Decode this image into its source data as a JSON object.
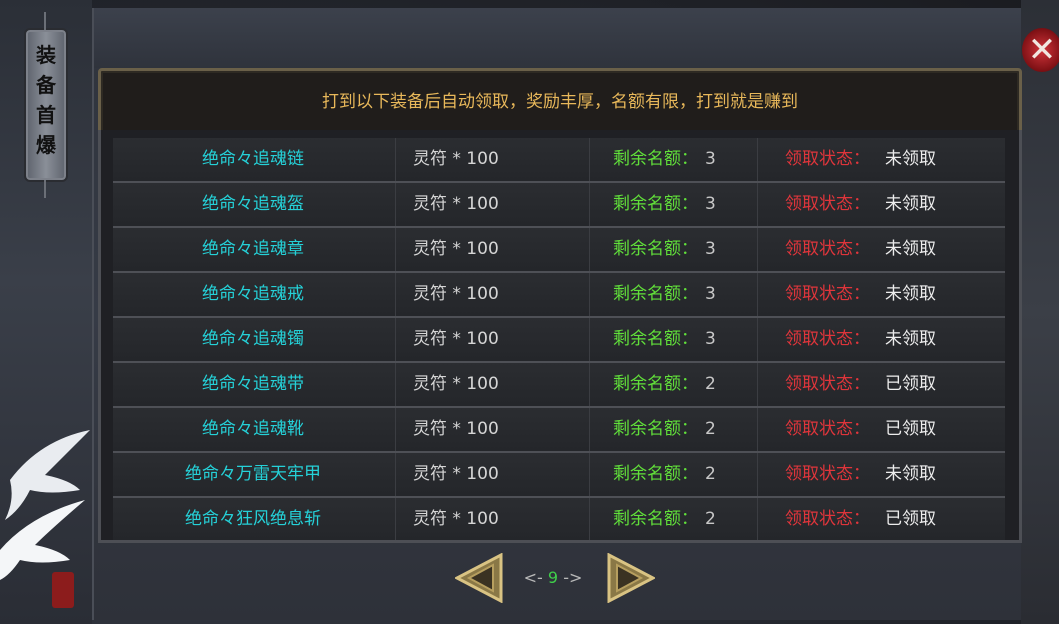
{
  "side_tab": {
    "label": [
      "装",
      "备",
      "首",
      "爆"
    ]
  },
  "banner": {
    "text": "打到以下装备后自动领取，奖励丰厚，名额有限，打到就是赚到"
  },
  "labels": {
    "quota": "剩余名额：",
    "status": "领取状态："
  },
  "rows": [
    {
      "name": "绝命々追魂链",
      "reward": "灵符 * 100",
      "quota": "3",
      "status": "未领取"
    },
    {
      "name": "绝命々追魂盔",
      "reward": "灵符 * 100",
      "quota": "3",
      "status": "未领取"
    },
    {
      "name": "绝命々追魂章",
      "reward": "灵符 * 100",
      "quota": "3",
      "status": "未领取"
    },
    {
      "name": "绝命々追魂戒",
      "reward": "灵符 * 100",
      "quota": "3",
      "status": "未领取"
    },
    {
      "name": "绝命々追魂镯",
      "reward": "灵符 * 100",
      "quota": "3",
      "status": "未领取"
    },
    {
      "name": "绝命々追魂带",
      "reward": "灵符 * 100",
      "quota": "2",
      "status": "已领取"
    },
    {
      "name": "绝命々追魂靴",
      "reward": "灵符 * 100",
      "quota": "2",
      "status": "已领取"
    },
    {
      "name": "绝命々万雷天牢甲",
      "reward": "灵符 * 100",
      "quota": "2",
      "status": "未领取"
    },
    {
      "name": "绝命々狂风绝息斩",
      "reward": "灵符 * 100",
      "quota": "2",
      "status": "已领取"
    }
  ],
  "pager": {
    "left": "<-",
    "page": "9",
    "right": "->"
  },
  "close": {
    "glyph": "✕"
  },
  "colors": {
    "name": "#25d1d8",
    "quota": "#61e03a",
    "status": "#e0353b",
    "banner": "#e8b85a"
  }
}
